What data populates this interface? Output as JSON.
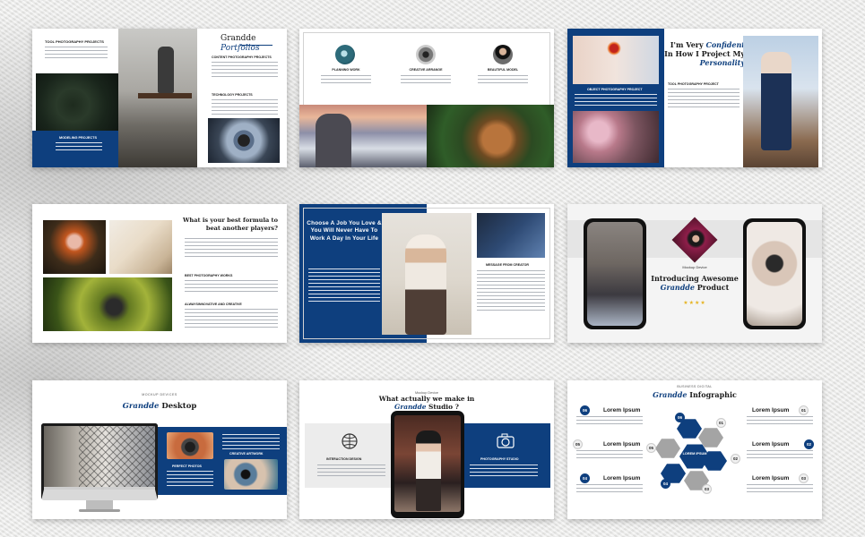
{
  "slide1": {
    "tag_label": "TOOL PHOTOGRAPHY PROJECTS",
    "brand_word": "Grandde",
    "brand_accent": "Portfolios",
    "section_content": "CONTENT PHOTOGRAPHY PROJECTS",
    "section_technology": "TECHNOLOGY PROJECTS",
    "caption": "MODELING PROJECTS"
  },
  "slide2": {
    "items": [
      {
        "label": "PLANNING WORK"
      },
      {
        "label": "CREATIVE ARRANGE"
      },
      {
        "label": "BEAUTIFUL MODEL"
      }
    ]
  },
  "slide3": {
    "headline_pre": "I'm Very",
    "headline_bold": "Confident",
    "headline_post": "In How I Project My",
    "headline_accent": "Personality",
    "section_object": "OBJECT PHOTOGRAPHY PROJECT",
    "section_tool": "TOOL PHOTOGRAPHY PROJECT"
  },
  "slide4": {
    "heading": "What is your best formula to beat another players?",
    "section_best": "BEST PHOTOGRAPHY WORKS",
    "section_always": "ALWAYSINNOVATIVE AND CREATIVE"
  },
  "slide5": {
    "quote": "Choose A Job You Love & You Will Never Have To Work A Day In Your Life",
    "message_label": "MESSAGE FROM CREATOR"
  },
  "slide6": {
    "caption": "Mockup Device",
    "title_line1": "Introducing Awesome",
    "title_brand": "Grandde",
    "title_product": "Product",
    "stars": "★★★★"
  },
  "slide7": {
    "kicker": "MOCKUP DEVICES",
    "title_brand": "Grandde",
    "title_rest": "Desktop",
    "label_perfect": "PERFECT PHOTOS",
    "label_creative": "CREATIVE ARTWORK"
  },
  "slide8": {
    "kicker": "Mockup Device",
    "title_line1": "What actually we make in",
    "title_brand": "Grandde",
    "title_rest": "Studio ?",
    "label_left": "INTERACTION DESIGN",
    "label_right": "PHOTOGRAPHY STUDIO"
  },
  "slide9": {
    "kicker": "BUSINESS DIGITAL",
    "title_brand": "Grandde",
    "title_rest": "Infographic",
    "center_label": "LOREM IPSUM",
    "item_title": "Lorem Ipsum",
    "numbers": [
      "01",
      "02",
      "03",
      "04",
      "05",
      "06"
    ]
  },
  "colors": {
    "brand_blue": "#0e3f7e",
    "wall_gray": "#e7e7e5"
  }
}
